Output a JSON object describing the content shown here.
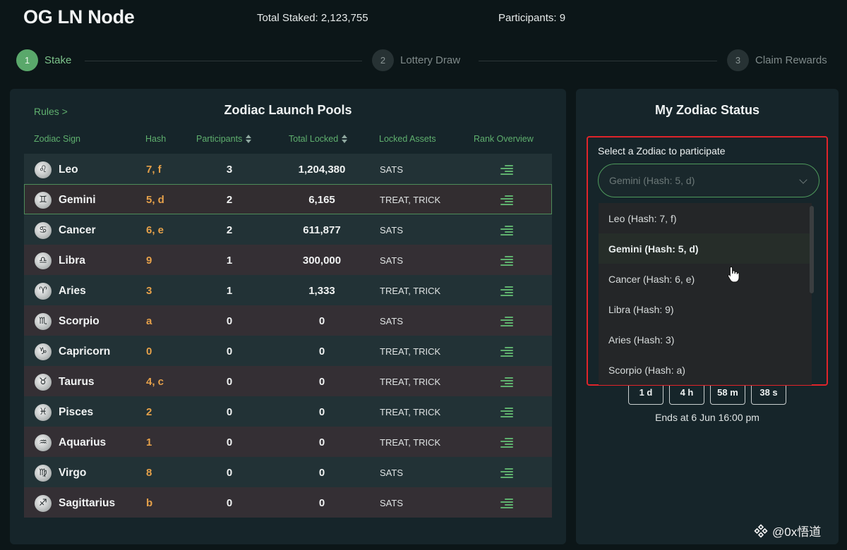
{
  "header": {
    "app_title": "OG LN Node",
    "total_staked": "Total Staked: 2,123,755",
    "participants": "Participants: 9"
  },
  "stepper": [
    {
      "number": "1",
      "label": "Stake",
      "active": true
    },
    {
      "number": "2",
      "label": "Lottery Draw",
      "active": false
    },
    {
      "number": "3",
      "label": "Claim Rewards",
      "active": false
    }
  ],
  "pools": {
    "rules_link": "Rules >",
    "title": "Zodiac Launch Pools",
    "columns": {
      "sign": "Zodiac Sign",
      "hash": "Hash",
      "participants": "Participants",
      "total_locked": "Total Locked",
      "assets": "Locked Assets",
      "rank": "Rank Overview"
    },
    "rows": [
      {
        "sign": "Leo",
        "glyph": "♌",
        "hash": "7, f",
        "participants": "3",
        "total": "1,204,380",
        "assets": "SATS"
      },
      {
        "sign": "Gemini",
        "glyph": "♊",
        "hash": "5, d",
        "participants": "2",
        "total": "6,165",
        "assets": "TREAT, TRICK",
        "selected": true
      },
      {
        "sign": "Cancer",
        "glyph": "♋",
        "hash": "6, e",
        "participants": "2",
        "total": "611,877",
        "assets": "SATS"
      },
      {
        "sign": "Libra",
        "glyph": "♎",
        "hash": "9",
        "participants": "1",
        "total": "300,000",
        "assets": "SATS"
      },
      {
        "sign": "Aries",
        "glyph": "♈",
        "hash": "3",
        "participants": "1",
        "total": "1,333",
        "assets": "TREAT, TRICK"
      },
      {
        "sign": "Scorpio",
        "glyph": "♏",
        "hash": "a",
        "participants": "0",
        "total": "0",
        "assets": "SATS"
      },
      {
        "sign": "Capricorn",
        "glyph": "♑",
        "hash": "0",
        "participants": "0",
        "total": "0",
        "assets": "TREAT, TRICK"
      },
      {
        "sign": "Taurus",
        "glyph": "♉",
        "hash": "4, c",
        "participants": "0",
        "total": "0",
        "assets": "TREAT, TRICK"
      },
      {
        "sign": "Pisces",
        "glyph": "♓",
        "hash": "2",
        "participants": "0",
        "total": "0",
        "assets": "TREAT, TRICK"
      },
      {
        "sign": "Aquarius",
        "glyph": "♒",
        "hash": "1",
        "participants": "0",
        "total": "0",
        "assets": "TREAT, TRICK"
      },
      {
        "sign": "Virgo",
        "glyph": "♍",
        "hash": "8",
        "participants": "0",
        "total": "0",
        "assets": "SATS"
      },
      {
        "sign": "Sagittarius",
        "glyph": "♐",
        "hash": "b",
        "participants": "0",
        "total": "0",
        "assets": "SATS"
      }
    ]
  },
  "status": {
    "title": "My Zodiac Status",
    "select_label": "Select a Zodiac to participate",
    "select_value": "Gemini (Hash: 5, d)",
    "options": [
      {
        "label": "Leo (Hash: 7, f)"
      },
      {
        "label": "Gemini (Hash: 5, d)",
        "selected": true
      },
      {
        "label": "Cancer (Hash: 6, e)"
      },
      {
        "label": "Libra (Hash: 9)"
      },
      {
        "label": "Aries (Hash: 3)"
      },
      {
        "label": "Scorpio (Hash: a)"
      }
    ],
    "countdown": [
      "1 d",
      "4 h",
      "58 m",
      "38 s"
    ],
    "ends_at": "Ends at 6 Jun 16:00 pm"
  },
  "watermark": "@0x悟道",
  "colors": {
    "accent_green": "#5fb06e",
    "hash_orange": "#e6a14a",
    "highlight_red": "#e0242a"
  }
}
